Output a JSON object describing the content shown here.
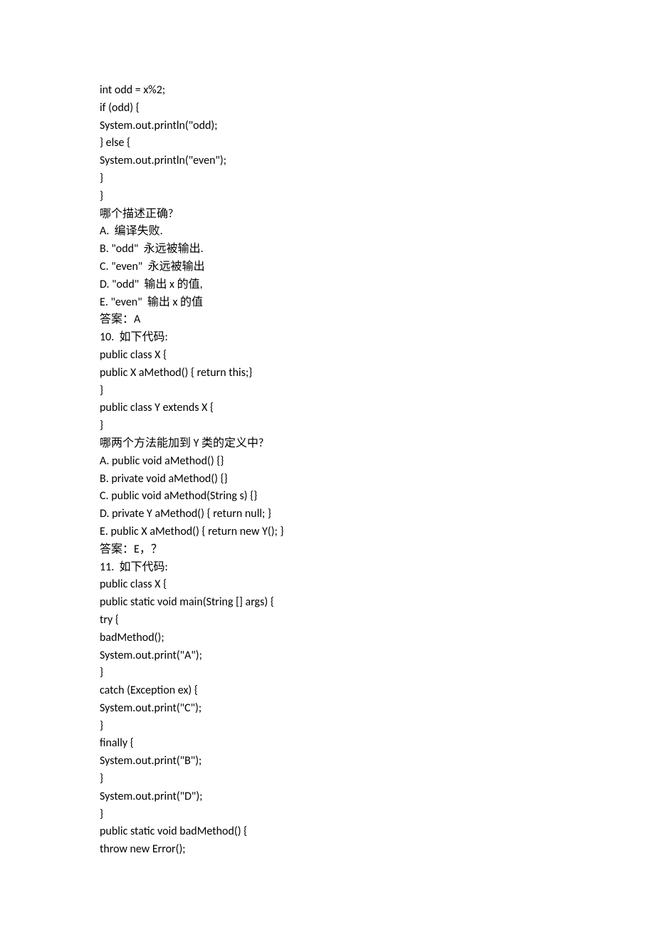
{
  "lines": [
    "int odd = x%2;",
    "if (odd) {",
    "System.out.println(\"odd);",
    "} else {",
    "System.out.println(\"even\");",
    "}",
    "}",
    "哪个描述正确?",
    "A.  编译失败.",
    "B. \"odd\"  永远被输出.",
    "C. \"even\"  永远被输出",
    "D. \"odd\"  输出 x 的值,",
    "E. \"even\"  输出 x 的值",
    "答案：A",
    "10.  如下代码:",
    "public class X {",
    "public X aMethod() { return this;}",
    "}",
    "public class Y extends X {",
    "}",
    "哪两个方法能加到 Y 类的定义中?",
    "A. public void aMethod() {}",
    "B. private void aMethod() {}",
    "C. public void aMethod(String s) {}",
    "D. private Y aMethod() { return null; }",
    "E. public X aMethod() { return new Y(); }",
    "答案：E，？",
    "11.  如下代码:",
    "public class X {",
    "public static void main(String [] args) {",
    "try {",
    "badMethod();",
    "System.out.print(\"A\");",
    "}",
    "catch (Exception ex) {",
    "System.out.print(\"C\");",
    "}",
    "finally {",
    "System.out.print(\"B\");",
    "}",
    "System.out.print(\"D\");",
    "}",
    "public static void badMethod() {",
    "throw new Error();"
  ]
}
